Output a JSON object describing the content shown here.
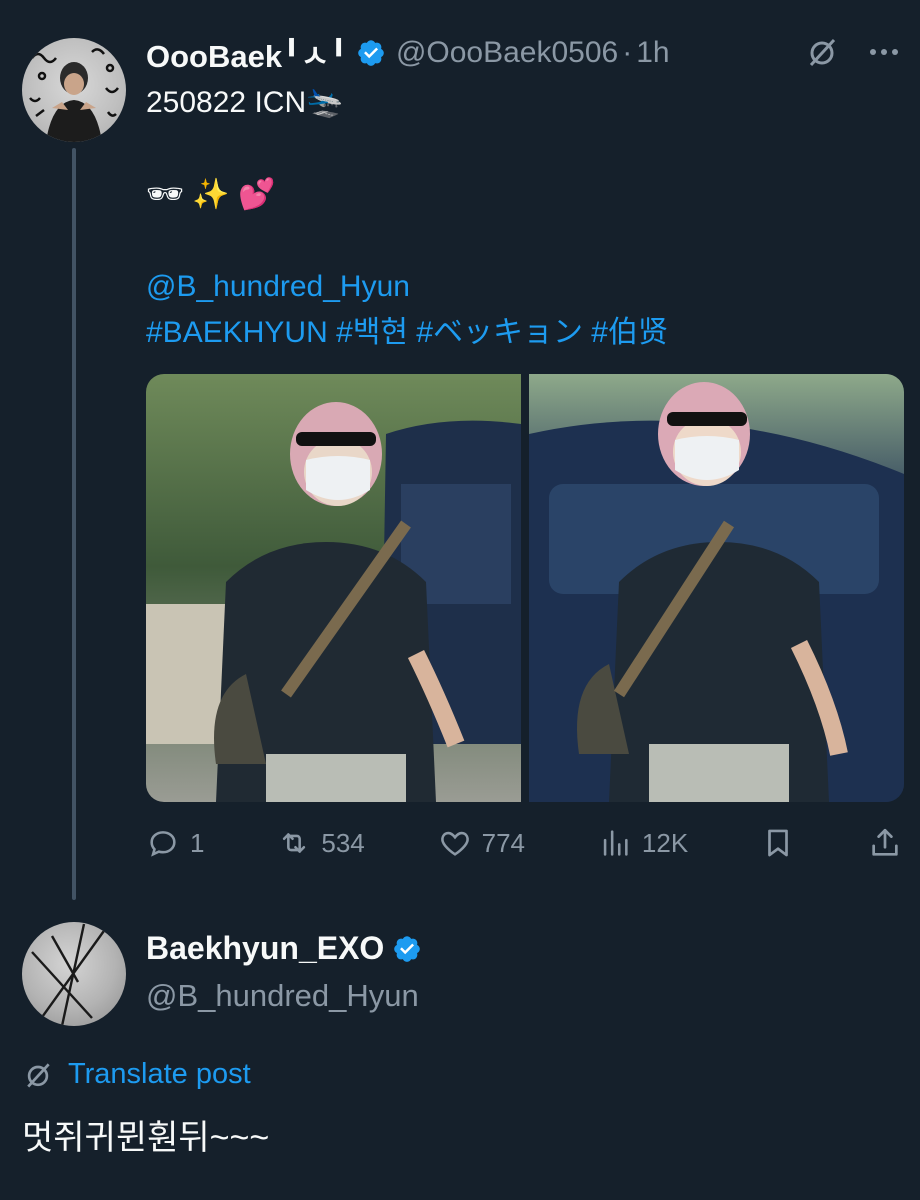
{
  "post": {
    "display_name": "OooBaek╹ㅅ╹",
    "handle": "@OooBaek0506",
    "dot": "·",
    "time": "1h",
    "line1": "250822 ICN🛬",
    "line2": "🕶 ✨ 💕",
    "mention": "@B_hundred_Hyun",
    "hashtags": "#BAEKHYUN  #백현 #ベッキョン #伯贤",
    "images": [
      "photo-1",
      "photo-2"
    ],
    "stats": {
      "replies": "1",
      "reposts": "534",
      "likes": "774",
      "views": "12K"
    }
  },
  "reply": {
    "display_name": "Baekhyun_EXO",
    "handle": "@B_hundred_Hyun",
    "translate_label": "Translate post",
    "text": "멋쥐귀뮌훤뒤~~~"
  },
  "icons": {
    "verified": "verified-badge-icon",
    "grok": "grok-icon",
    "more": "more-icon",
    "reply": "reply-icon",
    "repost": "repost-icon",
    "like": "like-icon",
    "views": "views-icon",
    "bookmark": "bookmark-icon",
    "share": "share-icon",
    "translate": "translate-icon"
  },
  "colors": {
    "background": "#15202b",
    "accent": "#1d9bf0",
    "muted": "#8b98a5",
    "text": "#f7f9f9"
  }
}
